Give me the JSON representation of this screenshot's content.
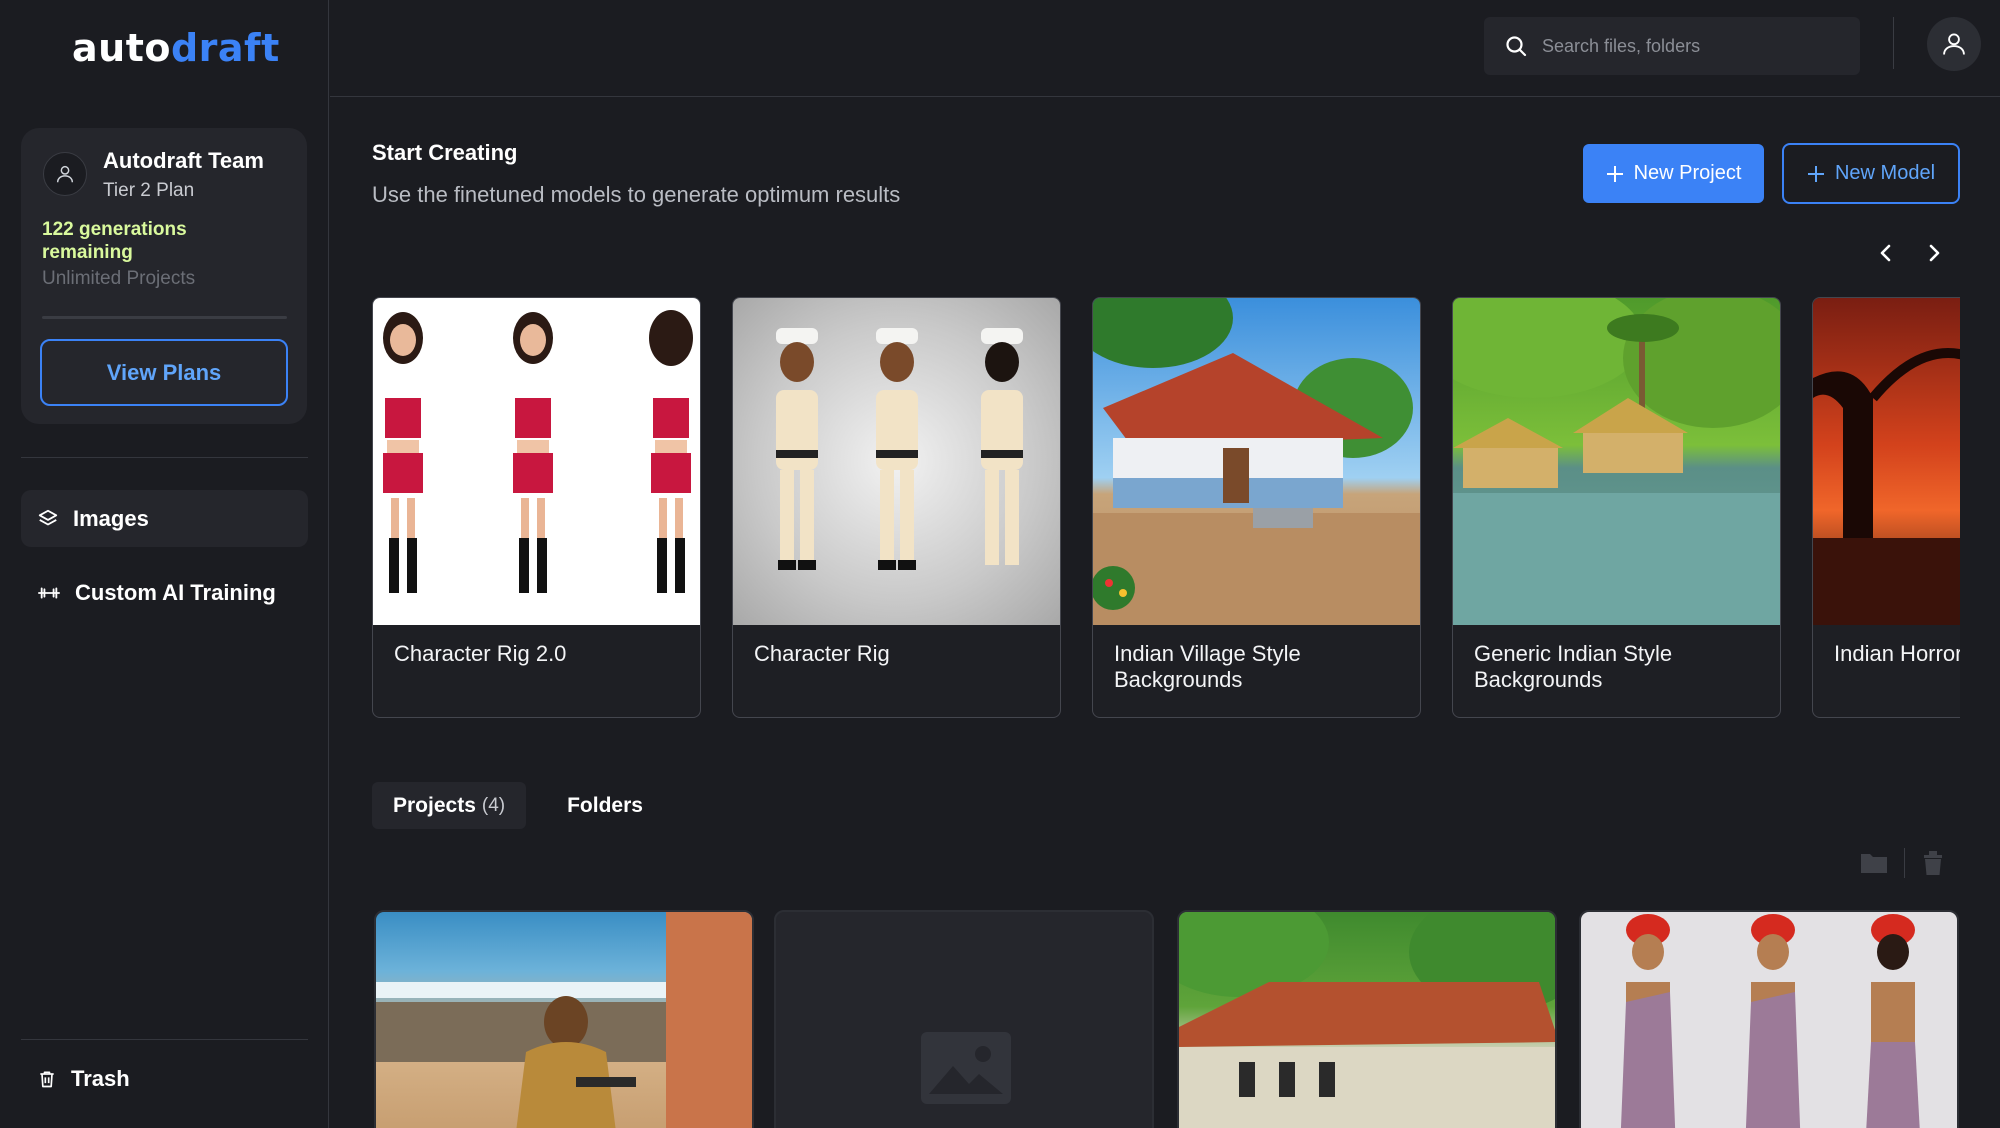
{
  "app": {
    "logo_part1": "auto",
    "logo_part2": "draft",
    "accent_color": "#3b82f6"
  },
  "account": {
    "name": "Autodraft Team",
    "plan": "Tier 2 Plan",
    "generations": "122 generations remaining",
    "projects": "Unlimited Projects",
    "view_plans": "View Plans"
  },
  "nav": {
    "items": [
      {
        "label": "Images",
        "icon": "layers-icon",
        "active": true
      },
      {
        "label": "Custom AI Training",
        "icon": "dumbbell-icon",
        "active": false
      }
    ],
    "trash": "Trash"
  },
  "header": {
    "search_placeholder": "Search files, folders"
  },
  "main": {
    "title": "Start Creating",
    "subtitle": "Use the finetuned models to generate optimum results",
    "new_project": "New Project",
    "new_model": "New Model",
    "models": [
      {
        "label": "Character Rig 2.0"
      },
      {
        "label": "Character Rig"
      },
      {
        "label": "Indian Village Style Backgrounds"
      },
      {
        "label": "Generic Indian Style Backgrounds"
      },
      {
        "label": "Indian Horror Backgrounds"
      }
    ],
    "tabs": [
      {
        "label": "Projects",
        "count": "(4)"
      },
      {
        "label": "Folders",
        "count": ""
      }
    ]
  }
}
